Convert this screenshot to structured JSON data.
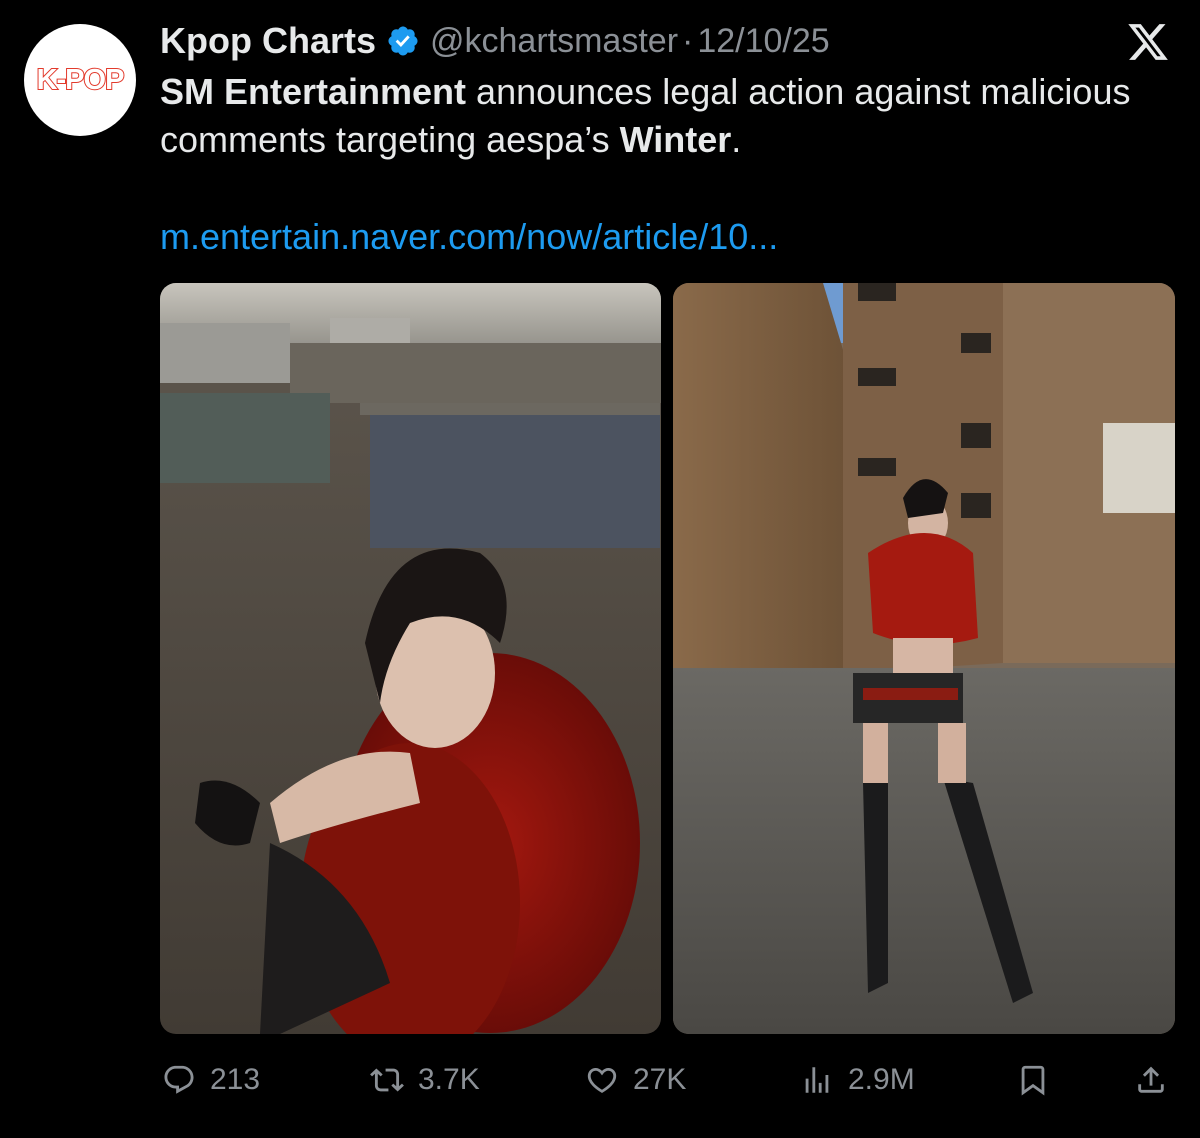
{
  "account": {
    "avatar_text": "K-POP",
    "display_name": "Kpop Charts",
    "handle": "@kchartsmaster",
    "separator": "·",
    "date": "12/10/25"
  },
  "tweet": {
    "text_bold_1": "SM Entertainment",
    "text_plain_1": " announces legal action against malicious comments targeting aespa’s ",
    "text_bold_2": "Winter",
    "text_plain_2": ".",
    "link": "m.entertain.naver.com/now/article/10..."
  },
  "stats": {
    "replies": "213",
    "reposts": "3.7K",
    "likes": "27K",
    "views": "2.9M"
  },
  "colors": {
    "background": "#000000",
    "text": "#e7e9ea",
    "muted": "#8b9096",
    "link": "#1d9bf0",
    "verified": "#1d9bf0",
    "avatar_accent": "#e23a2c"
  },
  "icons": [
    "verified-badge-icon",
    "x-logo-icon",
    "reply-icon",
    "repost-icon",
    "like-icon",
    "views-icon",
    "bookmark-icon",
    "share-icon"
  ]
}
